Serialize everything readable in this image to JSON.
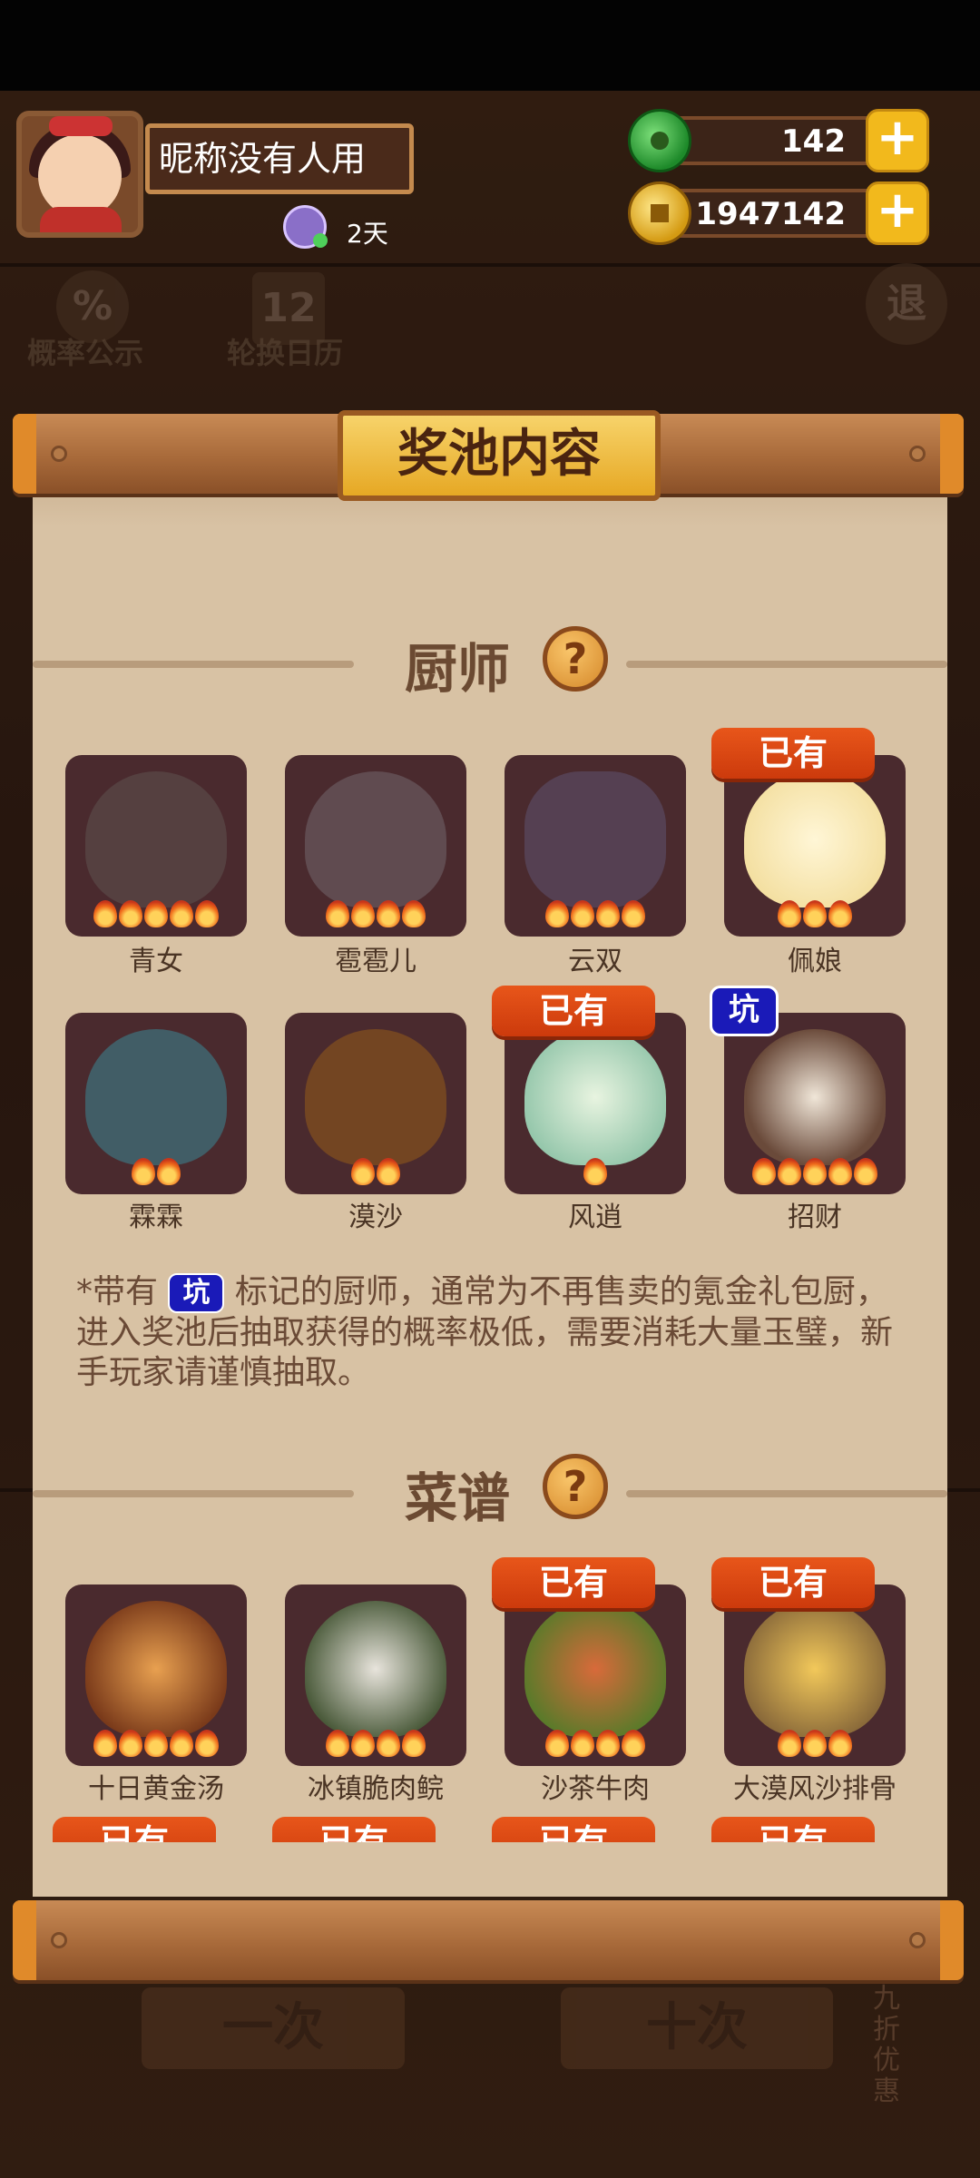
{
  "header": {
    "nickname": "昵称没有人用",
    "days": "2天",
    "jade_value": "142",
    "coin_value": "1947142"
  },
  "background": {
    "probability_label": "概率公示",
    "rotation_label": "轮换日历",
    "exit_label": "退",
    "single_draw": "一次",
    "ten_draw": "十次",
    "discount": "九折优惠"
  },
  "modal": {
    "title": "奖池内容",
    "chef_section": "厨师",
    "recipe_section": "菜谱",
    "help_symbol": "?",
    "owned_badge": "已有",
    "pit_badge": "坑",
    "note_prefix": "*带有",
    "note_suffix": "标记的厨师，通常为不再售卖的氪金礼包厨，进入奖池后抽取获得的概率极低，需要消耗大量玉璧，新手玩家请谨慎抽取。",
    "chefs": [
      {
        "name": "青女",
        "stars": 5,
        "owned": false,
        "pit": false
      },
      {
        "name": "雹雹儿",
        "stars": 4,
        "owned": false,
        "pit": false
      },
      {
        "name": "云双",
        "stars": 4,
        "owned": false,
        "pit": false
      },
      {
        "name": "佩娘",
        "stars": 3,
        "owned": true,
        "pit": false
      },
      {
        "name": "霖霖",
        "stars": 2,
        "owned": false,
        "pit": false
      },
      {
        "name": "漠沙",
        "stars": 2,
        "owned": false,
        "pit": false
      },
      {
        "name": "风逍",
        "stars": 1,
        "owned": true,
        "pit": false
      },
      {
        "name": "招财",
        "stars": 5,
        "owned": false,
        "pit": true
      }
    ],
    "recipes": [
      {
        "name": "十日黄金汤",
        "stars": 5,
        "owned": false
      },
      {
        "name": "冰镇脆肉鲩",
        "stars": 4,
        "owned": false
      },
      {
        "name": "沙茶牛肉",
        "stars": 4,
        "owned": true
      },
      {
        "name": "大漠风沙排骨",
        "stars": 3,
        "owned": true
      }
    ]
  },
  "colors": {
    "panel": "#d8c2a4",
    "owned_badge": "#dc4a14",
    "pit_badge": "#1a1ab8",
    "gold_plate": "#f2c24a"
  }
}
